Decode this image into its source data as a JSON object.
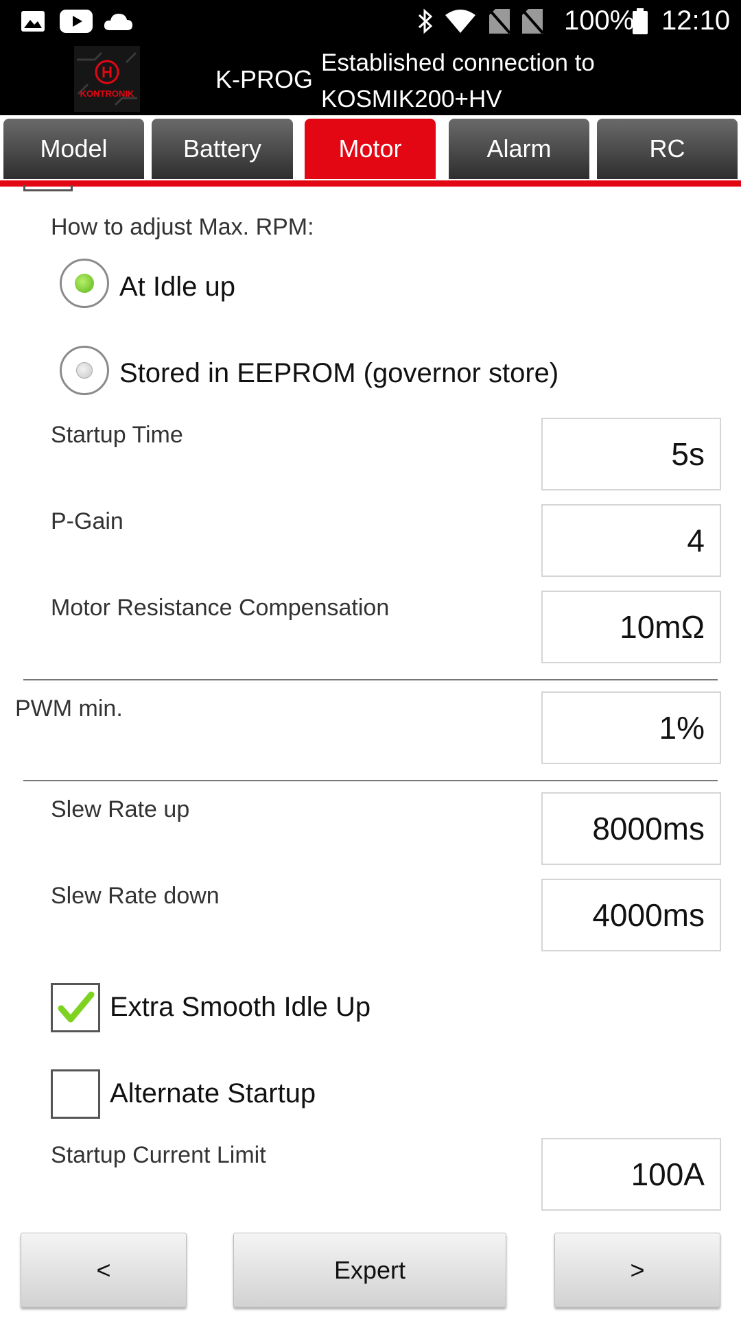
{
  "status_bar": {
    "left_icons": [
      "image-icon",
      "youtube-icon",
      "cloud-icon"
    ],
    "right_icons": [
      "bluetooth-icon",
      "wifi-icon",
      "no-sim-icon",
      "no-sim-icon",
      "battery-icon"
    ],
    "battery": "100%",
    "time": "12:10"
  },
  "app_bar": {
    "logo_text": "KONTRONIK",
    "app_name": "K-PROG",
    "connection_line1": "Established connection to",
    "connection_line2": "KOSMIK200+HV"
  },
  "tabs": [
    {
      "label": "Model",
      "active": false
    },
    {
      "label": "Battery",
      "active": false
    },
    {
      "label": "Motor",
      "active": true
    },
    {
      "label": "Alarm",
      "active": false
    },
    {
      "label": "RC",
      "active": false
    }
  ],
  "rpm": {
    "question": "How to adjust Max. RPM:",
    "options": [
      {
        "label": "At Idle up",
        "selected": true
      },
      {
        "label": "Stored in EEPROM (governor store)",
        "selected": false
      }
    ]
  },
  "settings": [
    {
      "label": "Startup Time",
      "value": "5s"
    },
    {
      "label": "P-Gain",
      "value": "4"
    },
    {
      "label": "Motor Resistance Compensation",
      "value": "10mΩ"
    },
    {
      "label": "PWM min.",
      "value": "1%"
    },
    {
      "label": "Slew Rate up",
      "value": "8000ms"
    },
    {
      "label": "Slew Rate down",
      "value": "4000ms"
    },
    {
      "label": "Startup Current Limit",
      "value": "100A"
    }
  ],
  "checkboxes": [
    {
      "label": "Extra Smooth Idle Up",
      "checked": true
    },
    {
      "label": "Alternate Startup",
      "checked": false
    }
  ],
  "buttons": {
    "prev": "<",
    "expert": "Expert",
    "next": ">"
  },
  "colors": {
    "accent": "#e30613",
    "radio_selected": "#7ed321",
    "check": "#7ed321"
  }
}
